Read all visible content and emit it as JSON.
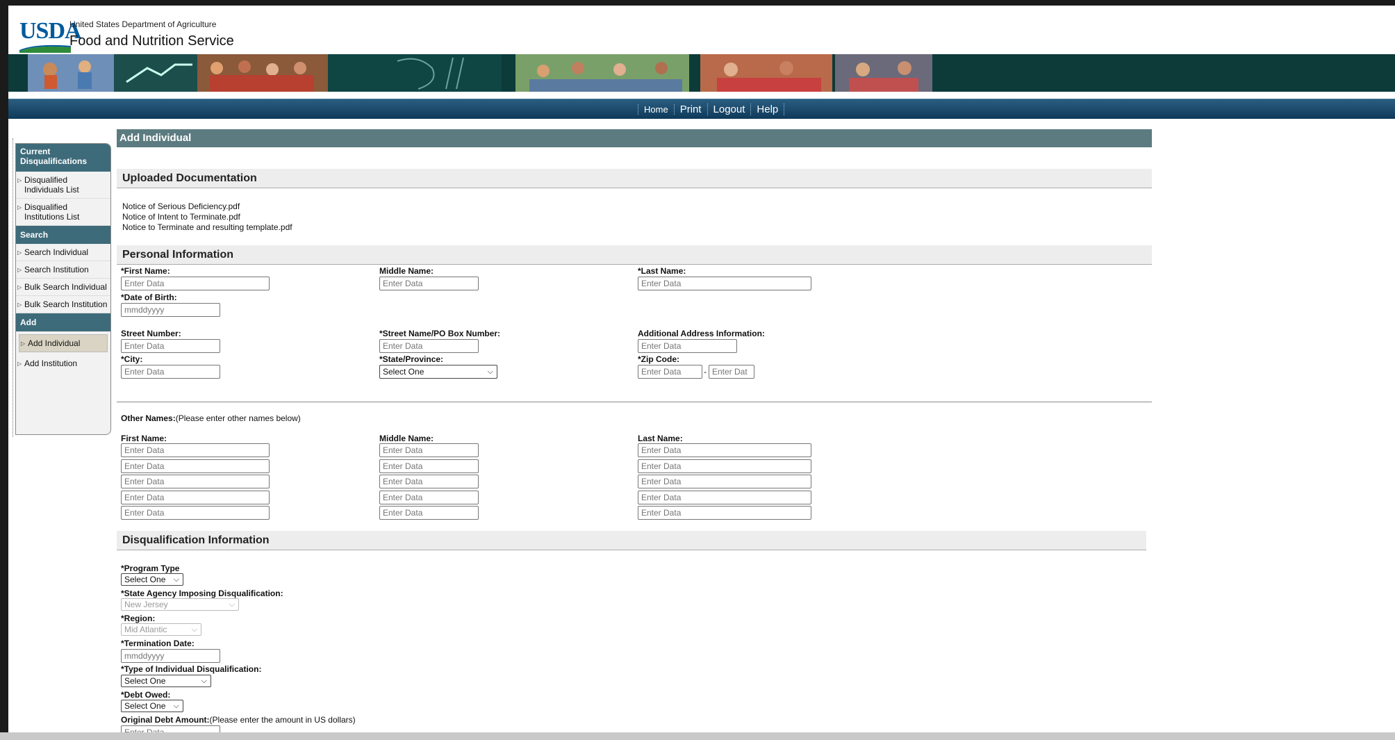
{
  "header": {
    "logo_text": "USDA",
    "department": "United States Department of Agriculture",
    "service": "Food and Nutrition Service"
  },
  "nav": {
    "links": [
      "Home",
      "Print",
      "Logout",
      "Help"
    ]
  },
  "sidebar": {
    "sections": [
      {
        "title": "Current Disqualifications",
        "items": [
          "Disqualified Individuals List",
          "Disqualified Institutions List"
        ]
      },
      {
        "title": "Search",
        "items": [
          "Search Individual",
          "Search Institution",
          "Bulk Search Individual",
          "Bulk Search Institution"
        ]
      },
      {
        "title": "Add",
        "items": [
          "Add Individual",
          "Add Institution"
        ]
      }
    ],
    "active_item": "Add Individual"
  },
  "page": {
    "title": "Add Individual"
  },
  "uploaded_docs": {
    "heading": "Uploaded Documentation",
    "files": [
      "Notice of Serious Deficiency.pdf",
      "Notice of Intent to Terminate.pdf",
      "Notice to Terminate and resulting template.pdf"
    ]
  },
  "personal": {
    "heading": "Personal Information",
    "first_name_label": "*First Name:",
    "middle_name_label": "Middle Name:",
    "last_name_label": "*Last Name:",
    "dob_label": "*Date of Birth:",
    "street_number_label": "Street Number:",
    "street_name_label": "*Street Name/PO Box Number:",
    "additional_address_label": "Additional Address Information:",
    "city_label": "*City:",
    "state_label": "*State/Province:",
    "zip_label": "*Zip Code:",
    "placeholder": "Enter Data",
    "date_placeholder": "mmddyyyy",
    "zip_ext_placeholder": "Enter Dat",
    "state_value": "Select One",
    "zip_sep": "-"
  },
  "other_names": {
    "label_bold": "Other Names:",
    "label_note": "(Please enter other names below)",
    "first_name_label": "First Name:",
    "middle_name_label": "Middle Name:",
    "last_name_label": "Last Name:",
    "row_count": 5
  },
  "disqualification": {
    "heading": "Disqualification Information",
    "program_type_label": "*Program Type",
    "program_type_value": "Select One",
    "state_agency_label": "*State Agency Imposing Disqualification:",
    "state_agency_value": "New Jersey",
    "region_label": "*Region:",
    "region_value": "Mid Atlantic",
    "termination_date_label": "*Termination Date:",
    "termination_date_placeholder": "mmddyyyy",
    "type_label": "*Type of Individual Disqualification:",
    "type_value": "Select One",
    "debt_owed_label": "*Debt Owed:",
    "debt_owed_value": "Select One",
    "original_debt_label_bold": "Original Debt Amount:",
    "original_debt_label_note": "(Please enter the amount in US dollars)",
    "original_debt_placeholder": "Enter Data"
  },
  "icons": {
    "dropdown": "chevron-down-icon",
    "list_bullet": "triangle-right-icon"
  },
  "colors": {
    "banner": "#0c3b3a",
    "navbar": "#0f3a5a",
    "title_bar": "#5b7b80",
    "sidebar_head": "#3e6b7a",
    "usda_blue": "#005a9c"
  }
}
